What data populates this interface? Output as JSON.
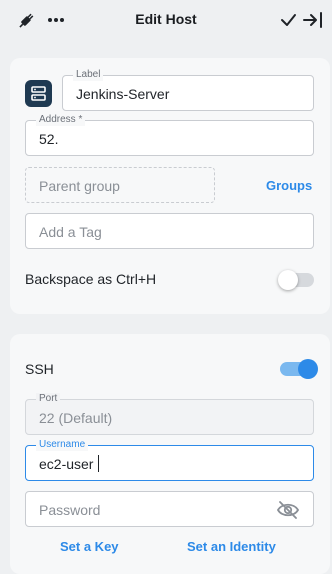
{
  "header": {
    "title": "Edit Host",
    "icons": [
      "plug-icon",
      "more-icon",
      "check-icon",
      "collapse-panel-icon"
    ]
  },
  "host": {
    "icon": "server-icon",
    "label_caption": "Label",
    "label_value": "Jenkins-Server",
    "address_caption": "Address *",
    "address_value": "52.",
    "parent_group_placeholder": "Parent group",
    "groups_link": "Groups",
    "tag_placeholder": "Add a Tag",
    "backspace_label": "Backspace as Ctrl+H",
    "backspace_enabled": false
  },
  "ssh": {
    "title": "SSH",
    "enabled": true,
    "port_caption": "Port",
    "port_placeholder": "22 (Default)",
    "username_caption": "Username",
    "username_value": "ec2-user",
    "password_placeholder": "Password",
    "password_icon": "eye-off-icon",
    "set_key_link": "Set a Key",
    "set_identity_link": "Set an Identity"
  },
  "colors": {
    "accent": "#2d8ae8",
    "server_icon_bg": "#1f3a52",
    "background": "#eef0f2",
    "card": "#f7f8f9"
  }
}
